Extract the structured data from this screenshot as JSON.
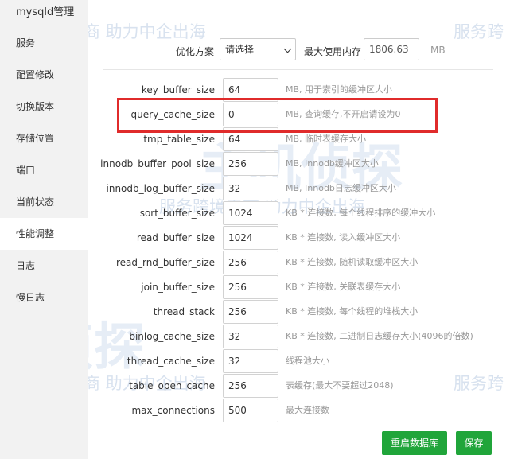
{
  "window": {
    "title": "mysqld管理"
  },
  "sidebar": {
    "items": [
      {
        "label": "服务"
      },
      {
        "label": "配置修改"
      },
      {
        "label": "切换版本"
      },
      {
        "label": "存储位置"
      },
      {
        "label": "端口"
      },
      {
        "label": "当前状态"
      },
      {
        "label": "性能调整"
      },
      {
        "label": "日志"
      },
      {
        "label": "慢日志"
      }
    ],
    "active": "性能调整"
  },
  "toolbar": {
    "opt_label": "优化方案",
    "opt_select_value": "请选择",
    "mem_label": "最大使用内存",
    "mem_value": "1806.63",
    "mem_unit": "MB"
  },
  "settings": [
    {
      "name": "key_buffer_size",
      "value": "64",
      "desc": "MB, 用于索引的缓冲区大小"
    },
    {
      "name": "query_cache_size",
      "value": "0",
      "desc": "MB, 查询缓存,不开启请设为0"
    },
    {
      "name": "tmp_table_size",
      "value": "64",
      "desc": "MB, 临时表缓存大小"
    },
    {
      "name": "innodb_buffer_pool_size",
      "value": "256",
      "desc": "MB, Innodb缓冲区大小"
    },
    {
      "name": "innodb_log_buffer_size",
      "value": "32",
      "desc": "MB, Innodb日志缓冲区大小"
    },
    {
      "name": "sort_buffer_size",
      "value": "1024",
      "desc": "KB * 连接数, 每个线程排序的缓冲大小"
    },
    {
      "name": "read_buffer_size",
      "value": "1024",
      "desc": "KB * 连接数, 读入缓冲区大小"
    },
    {
      "name": "read_rnd_buffer_size",
      "value": "256",
      "desc": "KB * 连接数, 随机读取缓冲区大小"
    },
    {
      "name": "join_buffer_size",
      "value": "256",
      "desc": "KB * 连接数, 关联表缓存大小"
    },
    {
      "name": "thread_stack",
      "value": "256",
      "desc": "KB * 连接数, 每个线程的堆栈大小"
    },
    {
      "name": "binlog_cache_size",
      "value": "32",
      "desc": "KB * 连接数, 二进制日志缓存大小(4096的倍数)"
    },
    {
      "name": "thread_cache_size",
      "value": "32",
      "desc": "线程池大小"
    },
    {
      "name": "table_open_cache",
      "value": "256",
      "desc": "表缓存(最大不要超过2048)"
    },
    {
      "name": "max_connections",
      "value": "500",
      "desc": "最大连接数"
    }
  ],
  "buttons": {
    "restart": "重启数据库",
    "save": "保存"
  },
  "watermark": {
    "line1": "服务跨境电商 助力中企出海",
    "line2": "服务跨",
    "big": "主机侦探",
    "big2": "机侦探"
  },
  "colors": {
    "primary_button": "#20a53a",
    "highlight_border": "#e02b2b",
    "sidebar_bg": "#f2f2f2"
  }
}
